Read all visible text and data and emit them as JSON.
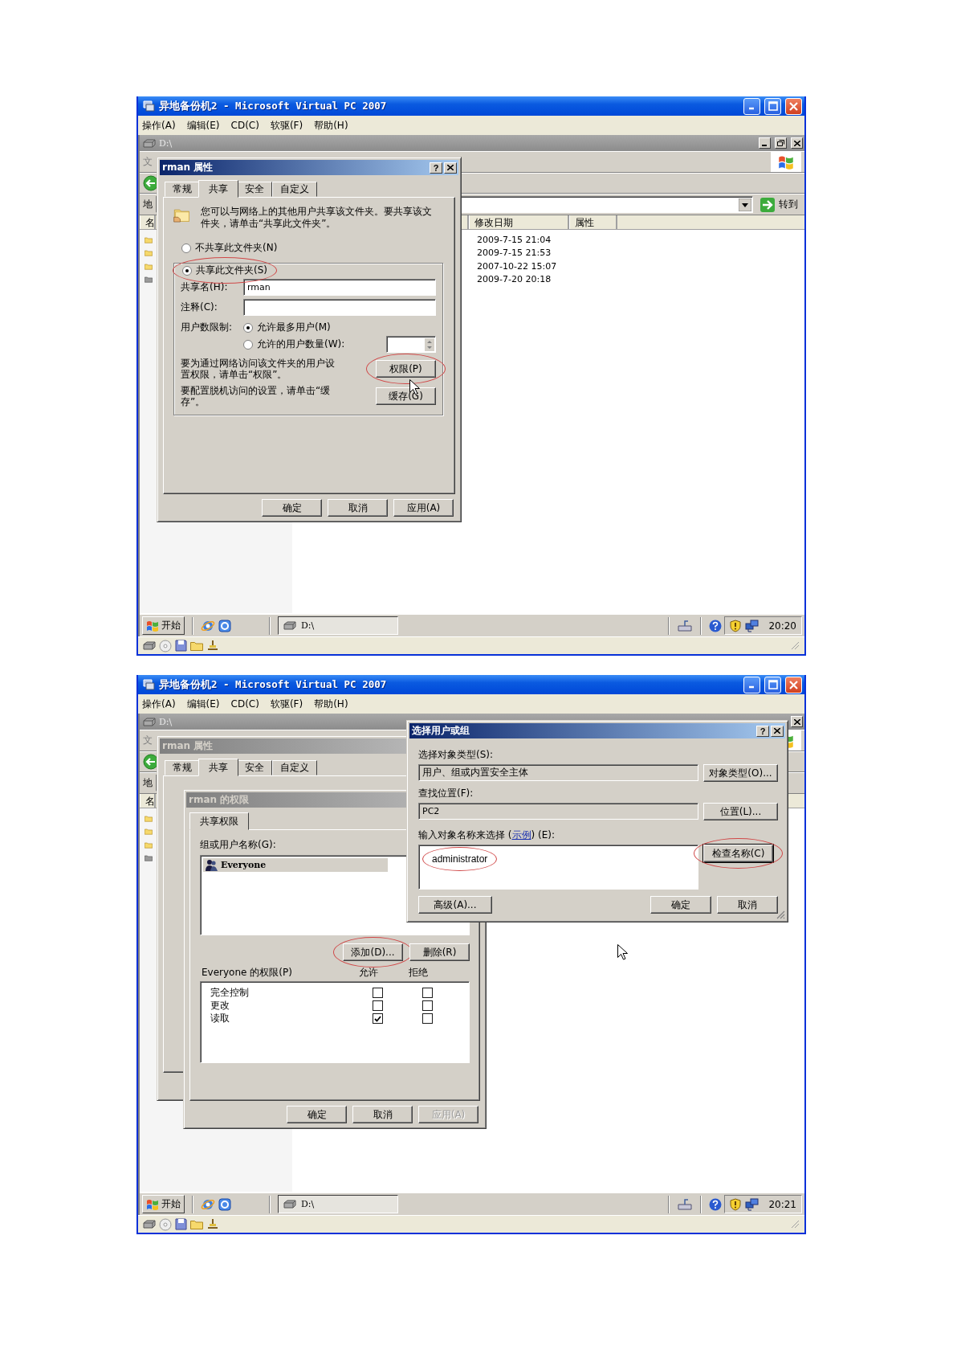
{
  "screenshots": [
    {
      "vpc": {
        "title": "异地备份机2 - Microsoft Virtual PC 2007",
        "menu": [
          "操作(A)",
          "编辑(E)",
          "CD(C)",
          "软驱(F)",
          "帮助(H)"
        ]
      },
      "explorer": {
        "title": "D:\\",
        "title_buttons": [
          {
            "kind": "minimize"
          },
          {
            "kind": "restore"
          },
          {
            "kind": "close"
          }
        ],
        "menu_text": "文",
        "address_label": "地",
        "go_button": "转到",
        "columns": [
          "名",
          "修改日期",
          "属性"
        ],
        "rows": [
          {
            "kind": "folder",
            "modified": "2009-7-15 21:04"
          },
          {
            "kind": "folder",
            "modified": "2009-7-15 21:53"
          },
          {
            "kind": "folder",
            "modified": "2007-10-22 15:07"
          },
          {
            "kind": "drive",
            "modified": "2009-7-20 20:18"
          }
        ]
      },
      "dialogs": [
        {
          "kind": "properties",
          "active": true,
          "title": "rman 属性",
          "help": "?",
          "tabs": [
            {
              "label": "常规",
              "selected": false
            },
            {
              "label": "共享",
              "selected": true
            },
            {
              "label": "安全",
              "selected": false
            },
            {
              "label": "自定义",
              "selected": false
            }
          ],
          "intro": "您可以与网络上的其他用户共享该文件夹。要共享该文件夹，请单击“共享此文件夹”。",
          "share_options": [
            {
              "label": "不共享此文件夹(N)",
              "selected": false,
              "circled": false
            },
            {
              "label": "共享此文件夹(S)",
              "selected": true,
              "circled": true
            }
          ],
          "share_name_label": "共享名(H):",
          "share_name": "rman",
          "comment_label": "注释(C):",
          "user_limit_label": "用户数限制:",
          "user_limit_options": [
            {
              "label": "允许最多用户(M)",
              "selected": true
            },
            {
              "label": "允许的用户数量(W):",
              "selected": false
            }
          ],
          "permissions_text": "要为通过网络访问该文件夹的用户设置权限，请单击“权限”。",
          "permissions_button": {
            "label": "权限(P)",
            "circled": true
          },
          "caching_text": "要配置脱机访问的设置，请单击“缓存”。",
          "caching_button": {
            "label": "缓存(G)",
            "circled": false
          },
          "buttons": [
            {
              "label": "确定",
              "disabled": false
            },
            {
              "label": "取消",
              "disabled": false
            },
            {
              "label": "应用(A)",
              "disabled": false
            }
          ]
        }
      ],
      "taskbar": {
        "start": "开始",
        "task": "D:\\",
        "clock": "20:20"
      }
    },
    {
      "vpc": {
        "title": "异地备份机2 - Microsoft Virtual PC 2007",
        "menu": [
          "操作(A)",
          "编辑(E)",
          "CD(C)",
          "软驱(F)",
          "帮助(H)"
        ]
      },
      "explorer": {
        "title": "D:\\",
        "title_buttons": [
          {
            "kind": "close"
          }
        ],
        "menu_text": "文",
        "address_label": "地",
        "columns": [
          "名"
        ],
        "rows": [
          {
            "kind": "folder"
          },
          {
            "kind": "folder"
          },
          {
            "kind": "folder"
          },
          {
            "kind": "drive"
          }
        ]
      },
      "dialogs": [
        {
          "kind": "properties",
          "active": false,
          "title": "rman 属性",
          "tabs": [
            {
              "label": "常规",
              "selected": false
            },
            {
              "label": "共享",
              "selected": true
            },
            {
              "label": "安全",
              "selected": false
            },
            {
              "label": "自定义",
              "selected": false
            }
          ]
        },
        {
          "kind": "permissions",
          "active": false,
          "title": "rman 的权限",
          "tabs": [
            {
              "label": "共享权限",
              "selected": true
            }
          ],
          "users_label": "组或用户名称(G):",
          "users": [
            {
              "name": "Everyone",
              "selected": true
            }
          ],
          "add_button": {
            "label": "添加(D)...",
            "circled": true
          },
          "remove_button": {
            "label": "删除(R)",
            "circled": false
          },
          "permissions_label": "Everyone 的权限(P)",
          "allow_header": "允许",
          "deny_header": "拒绝",
          "permissions": [
            {
              "name": "完全控制",
              "allow": false,
              "deny": false
            },
            {
              "name": "更改",
              "allow": false,
              "deny": false
            },
            {
              "name": "读取",
              "allow": true,
              "deny": false
            }
          ],
          "buttons": [
            {
              "label": "确定",
              "disabled": false
            },
            {
              "label": "取消",
              "disabled": false
            },
            {
              "label": "应用(A)",
              "disabled": true
            }
          ]
        },
        {
          "kind": "select_users",
          "active": true,
          "title": "选择用户或组",
          "help": "?",
          "type_label": "选择对象类型(S):",
          "type_value": "用户、组或内置安全主体",
          "type_button": "对象类型(O)...",
          "location_label": "查找位置(F):",
          "location_value": "PC2",
          "location_button": "位置(L)...",
          "names_label": "输入对象名称来选择 (",
          "names_link": "示例",
          "names_label_end": ") (E):",
          "names_value": {
            "text": "administrator",
            "circled": true
          },
          "check_button": {
            "label": "检查名称(C)",
            "circled": true
          },
          "advanced_button": "高级(A)...",
          "buttons": [
            {
              "label": "确定",
              "disabled": false
            },
            {
              "label": "取消",
              "disabled": false
            }
          ]
        }
      ],
      "taskbar": {
        "start": "开始",
        "task": "D:\\",
        "clock": "20:21"
      }
    }
  ]
}
